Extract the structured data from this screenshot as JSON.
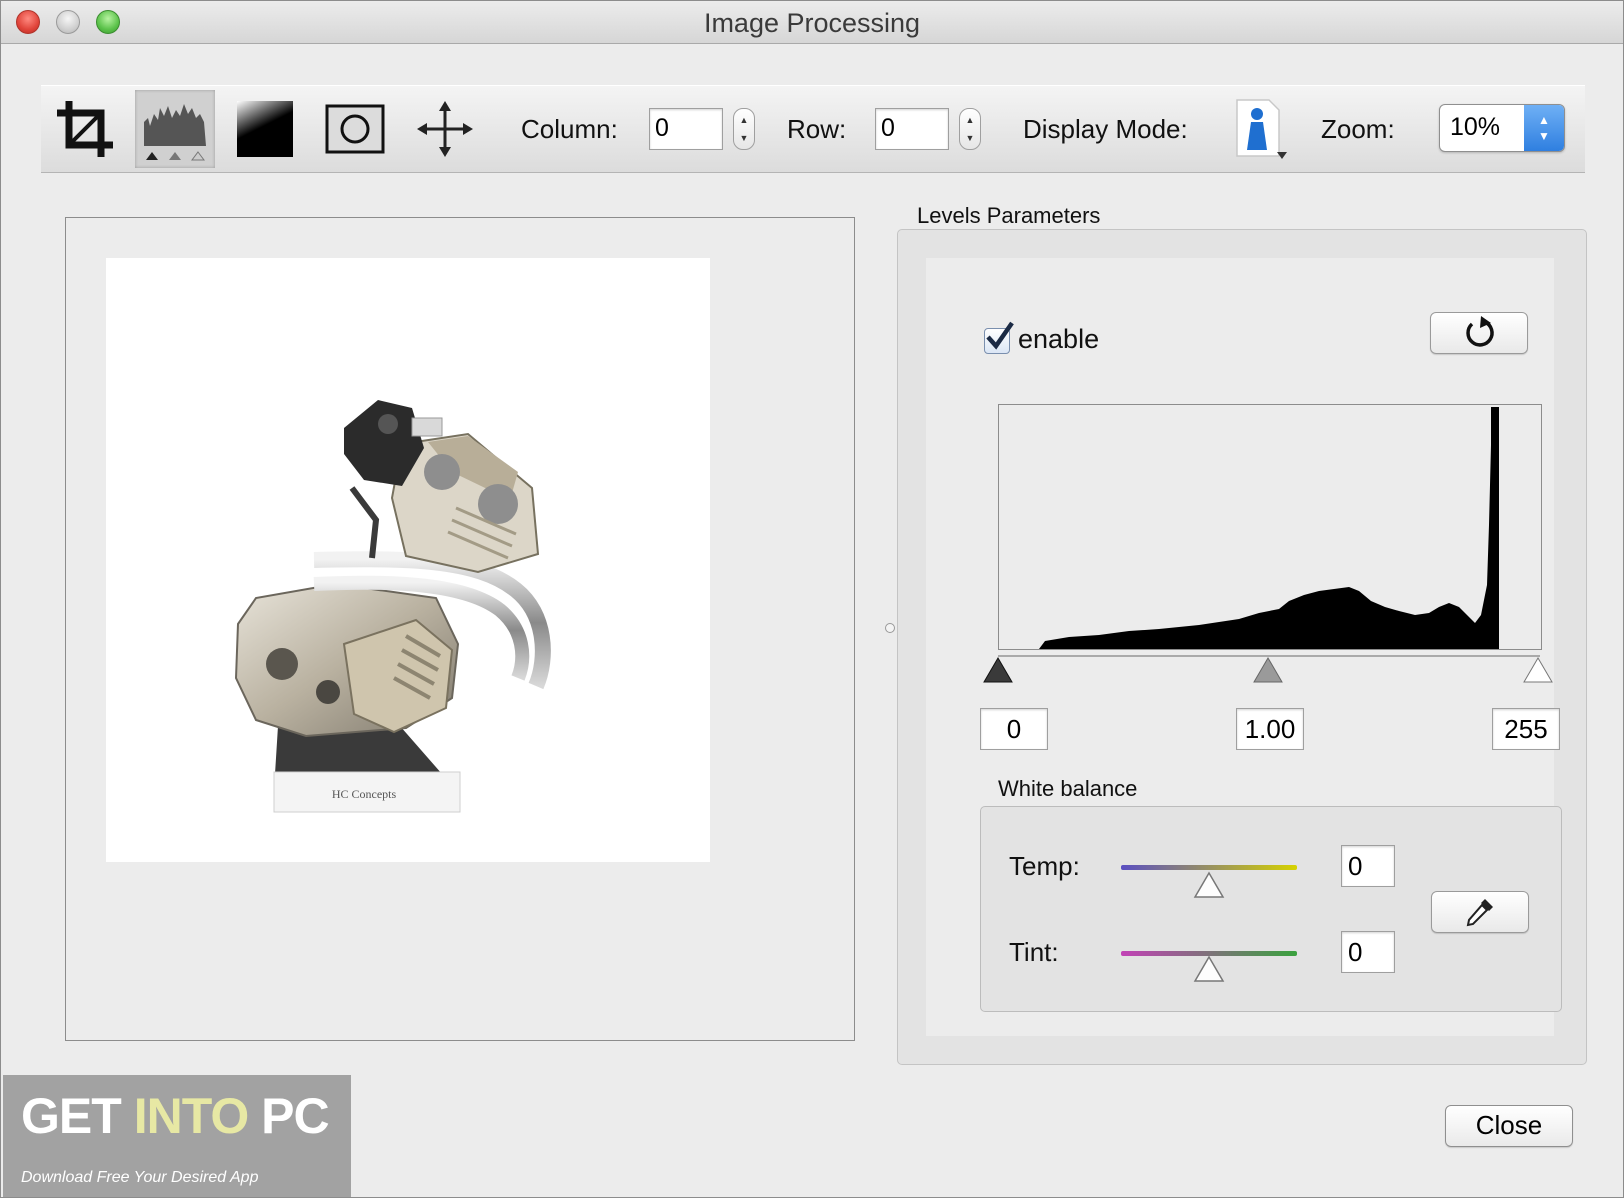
{
  "window": {
    "title": "Image Processing"
  },
  "toolbar": {
    "tools": [
      {
        "name": "crop-icon",
        "selected": false
      },
      {
        "name": "levels-icon",
        "selected": true
      },
      {
        "name": "gradient-icon",
        "selected": false
      },
      {
        "name": "vignette-icon",
        "selected": false
      },
      {
        "name": "move-icon",
        "selected": false
      }
    ],
    "column_label": "Column:",
    "column_value": "0",
    "row_label": "Row:",
    "row_value": "0",
    "display_mode_label": "Display Mode:",
    "display_mode_icon": "person-icon",
    "zoom_label": "Zoom:",
    "zoom_value": "10%"
  },
  "preview": {
    "logo_text": "HC Concepts"
  },
  "levels": {
    "title": "Levels Parameters",
    "enable_label": "enable",
    "enable_checked": true,
    "reset_icon": "reset-icon",
    "black_point": "0",
    "gamma": "1.00",
    "white_point": "255"
  },
  "white_balance": {
    "title": "White balance",
    "temp_label": "Temp:",
    "temp_value": "0",
    "tint_label": "Tint:",
    "tint_value": "0",
    "eyedropper_icon": "eyedropper-icon"
  },
  "watermark": {
    "part1": "GET ",
    "part2": "INTO ",
    "part3": "PC",
    "subtitle": "Download Free Your Desired App"
  },
  "footer": {
    "close_label": "Close"
  }
}
